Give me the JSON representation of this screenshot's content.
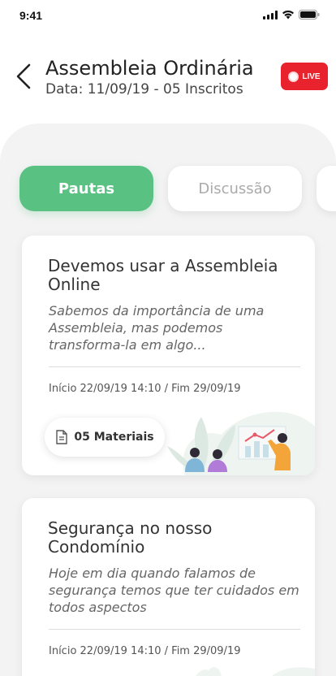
{
  "status_bar": {
    "time": "9:41"
  },
  "header": {
    "title": "Assembleia Ordinária",
    "subtitle": "Data: 11/09/19 - 05 Inscritos",
    "live_label": "LIVE"
  },
  "tabs": [
    {
      "label": "Pautas",
      "active": true
    },
    {
      "label": "Discussão",
      "active": false
    }
  ],
  "cards": [
    {
      "title": "Devemos usar a Assembleia Online",
      "description": "Sabemos da importância de uma Assembleia, mas podemos transforma-la em algo...",
      "dates": "Início 22/09/19 14:10 / Fim 29/09/19",
      "materials_label": "05 Materiais"
    },
    {
      "title": "Segurança no nosso Condomínio",
      "description": "Hoje em dia quando falamos de segurança temos que ter cuidados em todos aspectos",
      "dates": "Início 22/09/19 14:10 / Fim 29/09/19"
    }
  ],
  "colors": {
    "accent_green": "#59c182",
    "live_red": "#e8232e",
    "panel_bg": "#f3f3f3"
  },
  "icons": [
    "signal-icon",
    "wifi-icon",
    "battery-icon",
    "back-arrow-icon",
    "document-icon"
  ]
}
